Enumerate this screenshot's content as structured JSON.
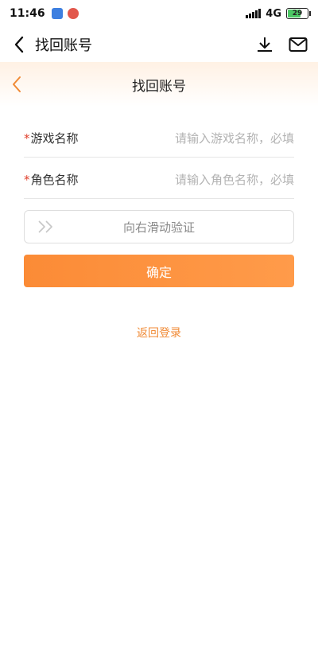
{
  "status_bar": {
    "time": "11:46",
    "network": "4G",
    "battery": "29"
  },
  "top_nav": {
    "title": "找回账号"
  },
  "header": {
    "title": "找回账号"
  },
  "form": {
    "fields": [
      {
        "required_mark": "*",
        "label": "游戏名称",
        "placeholder": "请输入游戏名称，必填"
      },
      {
        "required_mark": "*",
        "label": "角色名称",
        "placeholder": "请输入角色名称，必填"
      }
    ],
    "slider_text": "向右滑动验证",
    "confirm_label": "确定"
  },
  "back_login_label": "返回登录",
  "colors": {
    "accent": "#f08a35",
    "required": "#e0402c",
    "header_bg": "#fff1e4"
  }
}
